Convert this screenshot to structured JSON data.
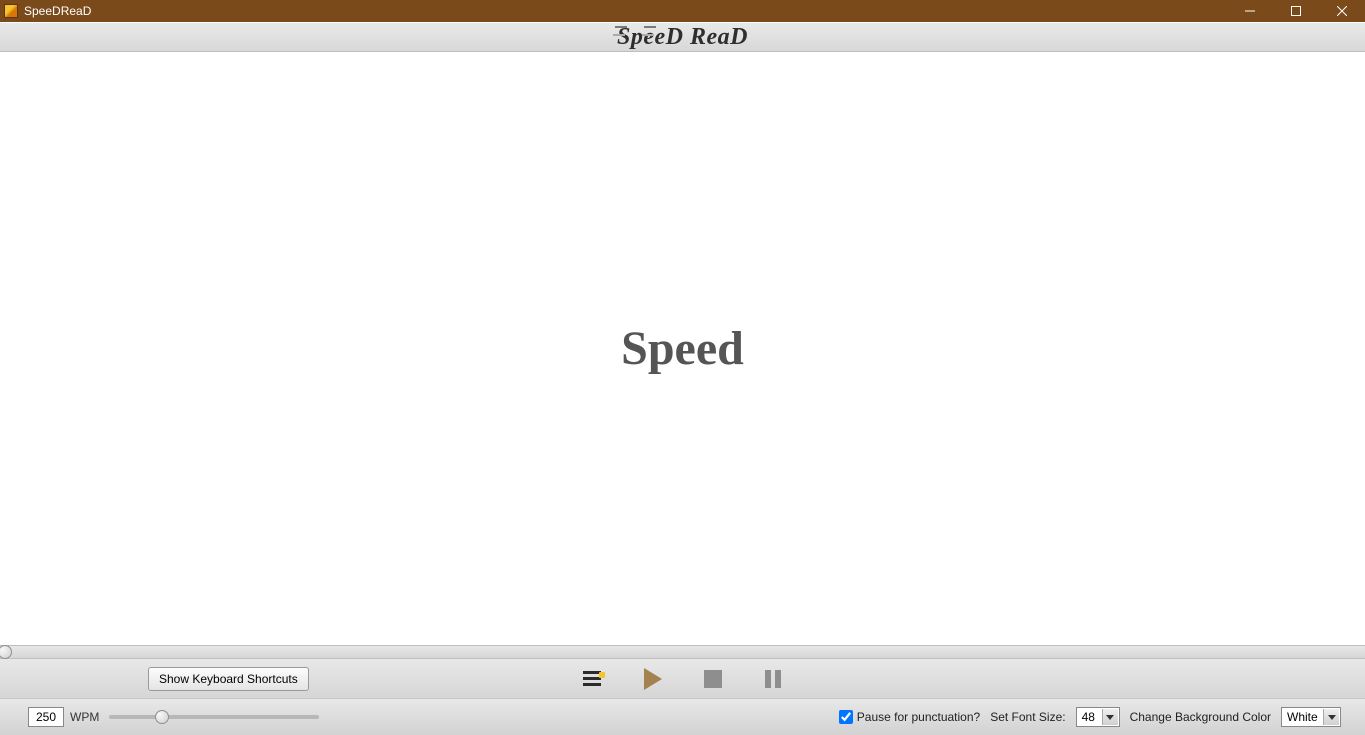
{
  "window": {
    "title": "SpeeDReaD"
  },
  "logo": {
    "text": "SpeeD ReaD"
  },
  "reader": {
    "current_word": "Speed"
  },
  "controls": {
    "shortcuts_button": "Show Keyboard Shortcuts",
    "wpm_value": "250",
    "wpm_label": "WPM",
    "pause_punctuation_label": "Pause for punctuation?",
    "pause_punctuation_checked": true,
    "font_size_label": "Set Font Size:",
    "font_size_value": "48",
    "bg_color_label": "Change Background Color",
    "bg_color_value": "White"
  }
}
